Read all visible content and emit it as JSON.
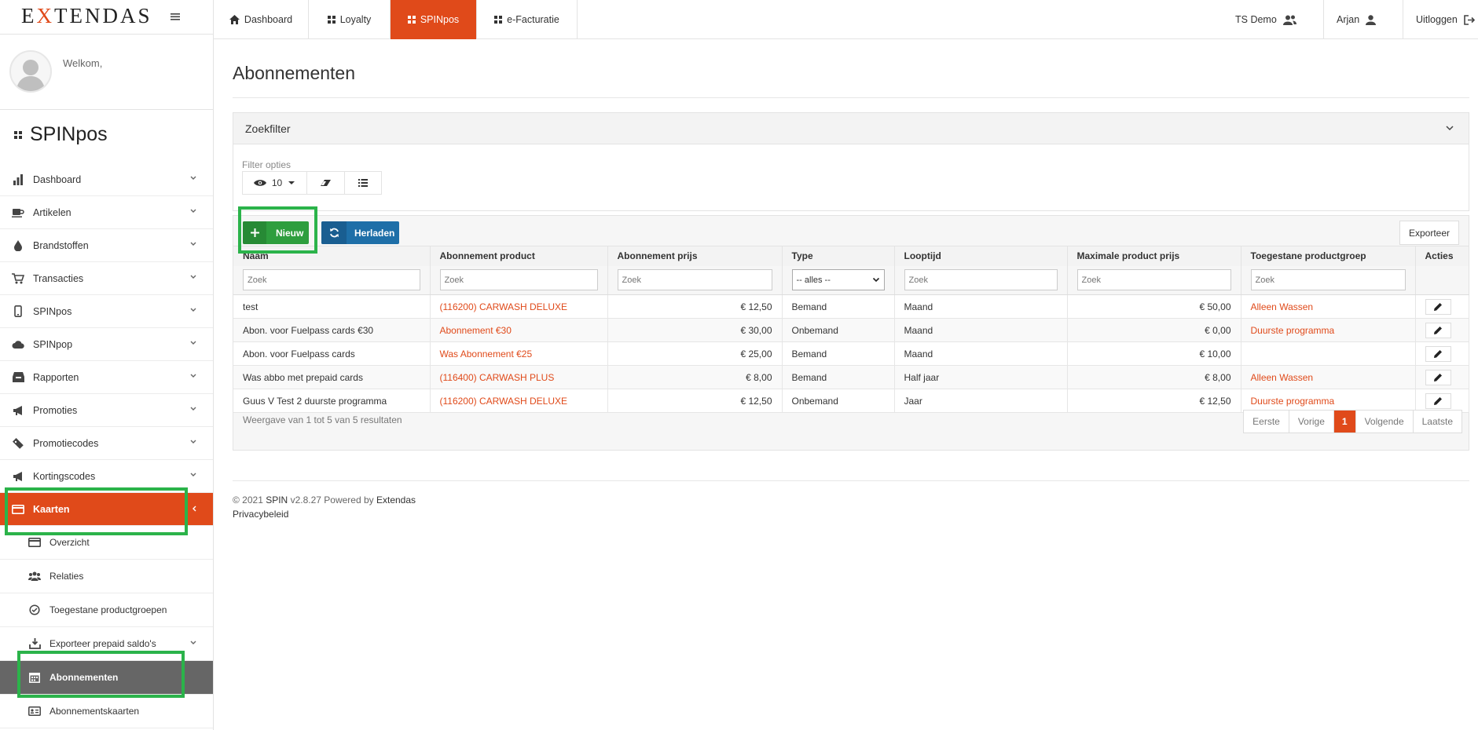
{
  "brand": {
    "logo_text": "EXTENDAS",
    "accent": "#e04a1a",
    "highlight": "#2bb34a"
  },
  "sidebar": {
    "welcome": "Welkom,",
    "app_name": "SPINpos",
    "menu": [
      {
        "label": "Dashboard",
        "icon": "bar-chart-icon"
      },
      {
        "label": "Artikelen",
        "icon": "coffee-cup-icon"
      },
      {
        "label": "Brandstoffen",
        "icon": "drop-icon"
      },
      {
        "label": "Transacties",
        "icon": "cart-icon"
      },
      {
        "label": "SPINpos",
        "icon": "mobile-icon"
      },
      {
        "label": "SPINpop",
        "icon": "cloud-icon"
      },
      {
        "label": "Rapporten",
        "icon": "inbox-icon"
      },
      {
        "label": "Promoties",
        "icon": "megaphone-icon"
      },
      {
        "label": "Promotiecodes",
        "icon": "ticket-icon"
      },
      {
        "label": "Kortingscodes",
        "icon": "megaphone-icon"
      },
      {
        "label": "Kaarten",
        "icon": "credit-card-icon",
        "active": true
      }
    ],
    "submenu": [
      {
        "label": "Overzicht",
        "icon": "credit-card-icon"
      },
      {
        "label": "Relaties",
        "icon": "users-icon"
      },
      {
        "label": "Toegestane productgroepen",
        "icon": "check-circle-icon"
      },
      {
        "label": "Exporteer prepaid saldo's",
        "icon": "download-icon"
      },
      {
        "label": "Abonnementen",
        "icon": "calendar-icon",
        "active": true
      },
      {
        "label": "Abonnementskaarten",
        "icon": "id-card-icon"
      }
    ]
  },
  "topnav": {
    "tabs": [
      {
        "label": "Dashboard",
        "icon": "home-icon"
      },
      {
        "label": "Loyalty",
        "icon": "grid-icon"
      },
      {
        "label": "SPINpos",
        "icon": "grid-icon",
        "active": true
      },
      {
        "label": "e-Facturatie",
        "icon": "grid-icon"
      }
    ],
    "company": "TS Demo",
    "user": "Arjan",
    "logout": "Uitloggen"
  },
  "page": {
    "title": "Abonnementen",
    "filter": {
      "title": "Zoekfilter",
      "options_label": "Filter opties",
      "page_size": "10"
    },
    "actions": {
      "new": "Nieuw",
      "reload": "Herladen",
      "export": "Exporteer"
    },
    "table": {
      "columns": [
        "Naam",
        "Abonnement product",
        "Abonnement prijs",
        "Type",
        "Looptijd",
        "Maximale product prijs",
        "Toegestane productgroep",
        "Acties"
      ],
      "search_placeholder": "Zoek",
      "type_filter": "-- alles --",
      "rows": [
        {
          "naam": "test",
          "product": "(116200) CARWASH DELUXE",
          "prijs": "€ 12,50",
          "type": "Bemand",
          "looptijd": "Maand",
          "max": "€ 50,00",
          "groep": "Alleen Wassen"
        },
        {
          "naam": "Abon. voor Fuelpass cards €30",
          "product": "Abonnement €30",
          "prijs": "€ 30,00",
          "type": "Onbemand",
          "looptijd": "Maand",
          "max": "€ 0,00",
          "groep": "Duurste programma"
        },
        {
          "naam": "Abon. voor Fuelpass cards",
          "product": "Was Abonnement €25",
          "prijs": "€ 25,00",
          "type": "Bemand",
          "looptijd": "Maand",
          "max": "€ 10,00",
          "groep": ""
        },
        {
          "naam": "Was abbo met prepaid cards",
          "product": "(116400) CARWASH PLUS",
          "prijs": "€ 8,00",
          "type": "Bemand",
          "looptijd": "Half jaar",
          "max": "€ 8,00",
          "groep": "Alleen Wassen"
        },
        {
          "naam": "Guus V Test 2 duurste programma",
          "product": "(116200) CARWASH DELUXE",
          "prijs": "€ 12,50",
          "type": "Onbemand",
          "looptijd": "Jaar",
          "max": "€ 12,50",
          "groep": "Duurste programma"
        }
      ]
    },
    "results_info": "Weergave van 1 tot 5 van 5 resultaten",
    "pagination": {
      "first": "Eerste",
      "prev": "Vorige",
      "current": "1",
      "next": "Volgende",
      "last": "Laatste"
    },
    "footer": {
      "copyright": "© 2021",
      "product": "SPIN",
      "version": "v2.8.27 Powered by",
      "company": "Extendas",
      "privacy": "Privacybeleid"
    }
  }
}
